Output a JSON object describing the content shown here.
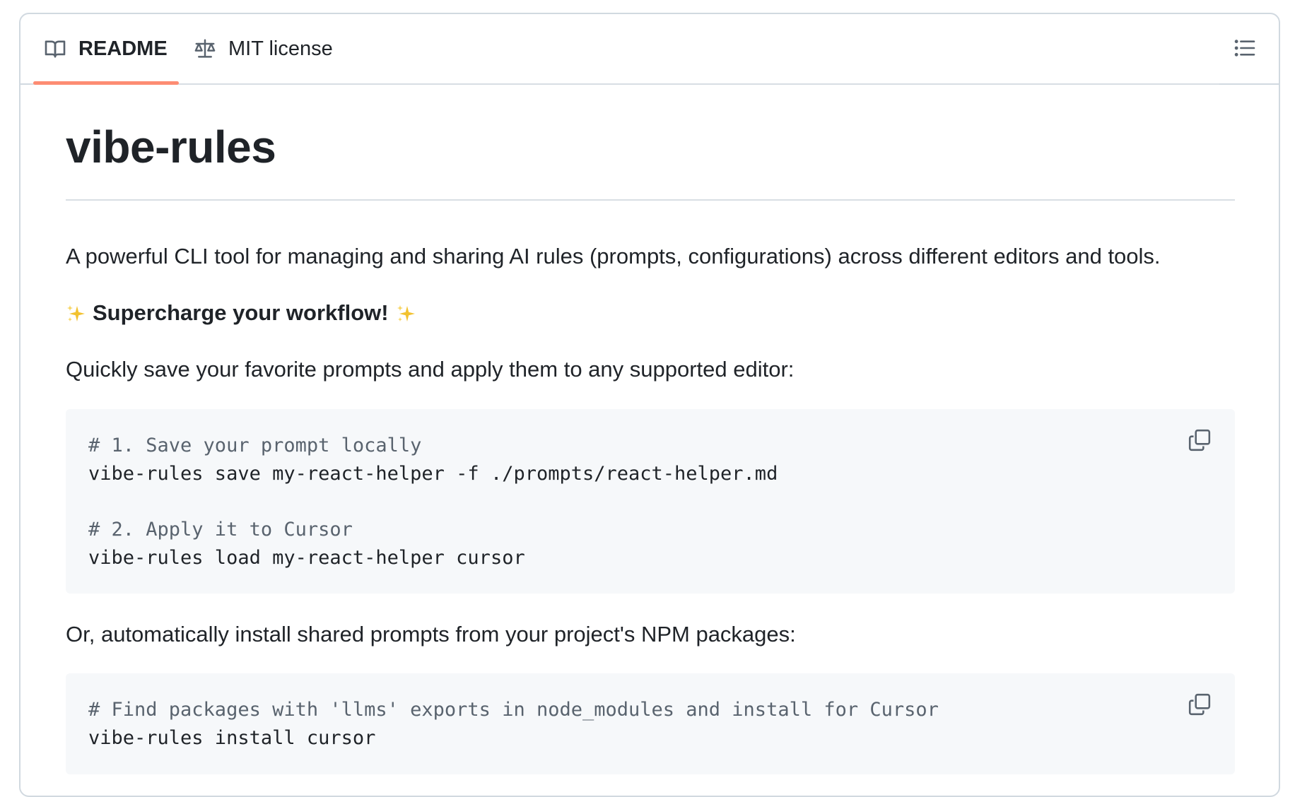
{
  "tabs": [
    {
      "label": "README",
      "icon": "book-icon",
      "active": true
    },
    {
      "label": "MIT license",
      "icon": "law-scale-icon",
      "active": false
    }
  ],
  "toc_icon": "list-unordered-icon",
  "readme": {
    "title": "vibe-rules",
    "description": "A powerful CLI tool for managing and sharing AI rules (prompts, configurations) across different editors and tools.",
    "tagline": "Supercharge your workflow!",
    "tagline_icon": "sparkles-icon",
    "intro_save": "Quickly save your favorite prompts and apply them to any supported editor:",
    "code_block_1": {
      "line1": "# 1. Save your prompt locally",
      "line2": "vibe-rules save my-react-helper -f ./prompts/react-helper.md",
      "line3": "# 2. Apply it to Cursor",
      "line4": "vibe-rules load my-react-helper cursor"
    },
    "intro_install": "Or, automatically install shared prompts from your project's NPM packages:",
    "code_block_2": {
      "line1": "# Find packages with 'llms' exports in node_modules and install for Cursor",
      "line2": "vibe-rules install cursor"
    }
  },
  "colors": {
    "accent_underline": "#fd8c73",
    "text": "#1f2328",
    "comment": "#59636e",
    "code_bg": "#f6f8fa",
    "border": "#d1d9e0",
    "sparkle": "#e3b341"
  }
}
